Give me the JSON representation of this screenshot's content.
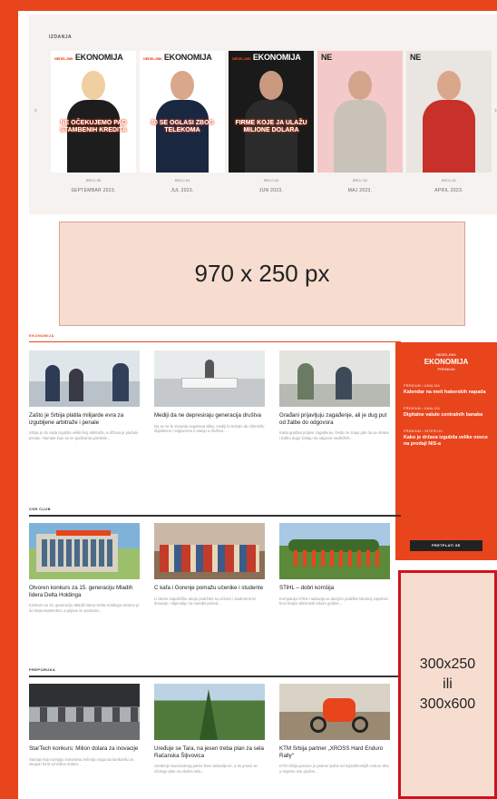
{
  "issues": {
    "label": "IZDANJA",
    "covers": [
      {
        "masthead": "EKONOMIJA",
        "masthead_prefix": "NEDELJNIK",
        "headline": "Ne očekujemo pad stambenih kredita",
        "issue_no": "BROJ 85",
        "date": "SEPTEMBAR 2023.",
        "bg": "#ffffff",
        "person_body": "#1d1d1d",
        "person_head": "#f0cfa0"
      },
      {
        "masthead": "EKONOMIJA",
        "masthead_prefix": "NEDELJNIK",
        "headline": "30 se oglasi zbog telekoma",
        "issue_no": "BROJ 84",
        "date": "JUL 2023.",
        "bg": "#ffffff",
        "person_body": "#1a2740",
        "person_head": "#d9a78a"
      },
      {
        "masthead": "EKONOMIJA",
        "masthead_prefix": "NEDELJNIK",
        "headline": "Firme koje ja ulažu milione dolara",
        "issue_no": "BROJ 83",
        "date": "JUN 2023.",
        "bg": "#1a1a1a",
        "person_body": "#2b2b2b",
        "person_head": "#c99a80"
      },
      {
        "masthead": "NE",
        "masthead_prefix": "",
        "headline": "",
        "issue_no": "BROJ 82",
        "date": "MAJ 2023.",
        "bg": "#f4c9c9",
        "person_body": "#c9c2b8",
        "person_head": "#d3a68c"
      },
      {
        "masthead": "NE",
        "masthead_prefix": "",
        "headline": "",
        "issue_no": "BROJ 81",
        "date": "APRIL 2023.",
        "bg": "#e9e5e0",
        "person_body": "#c8302a",
        "person_head": "#d9a78a"
      }
    ]
  },
  "ad_banner": {
    "text": "970 x 250 px"
  },
  "sections": {
    "finance": {
      "label": "EKONOMIJA",
      "cards": [
        {
          "title": "Zašto je Srbija platila milijarde evra za izgubljene arbitraže i penale",
          "excerpt": "Srbija je do sada izgubila veliki broj arbitraža, a država je plaćala penale i kamate koje su se godinama gomilale..."
        },
        {
          "title": "Mediji da ne depresiraju generacija društva",
          "excerpt": "Da se ne bi stvarala negativna slika, mediji bi trebalo da informišu objektivno i odgovorno o stanju u društvu..."
        },
        {
          "title": "Građani prijavljuju zagađenje, ali je dug put od žalbe do odgovora",
          "excerpt": "Kada građani prijave zagađenje, često ne znaju gde da se obrate i koliko dugo čekaju na odgovor nadležnih..."
        }
      ]
    },
    "csr": {
      "label": "CSR CLUB",
      "cards": [
        {
          "title": "Otvoren konkurs za 15. generaciju Mladih lidera Delta Holdinga",
          "excerpt": "Konkurs za 15. generaciju Mladih lidera Delta Holdinga otvoren je do kraja septembra, a prijave se podnose..."
        },
        {
          "title": "C kafa i Gorenje pomažu učenike i studente",
          "excerpt": "U okviru zajedničke akcije podržani su učenici i studenti kroz donacije i stipendije za naredni period..."
        },
        {
          "title": "STiHL – dobri komšija",
          "excerpt": "Kompanija STiHL nastavlja sa akcijom podrške lokalnoj zajednici kroz brojne aktivnosti tokom godine..."
        }
      ]
    },
    "recommend": {
      "label": "PREPORUKA",
      "cards": [
        {
          "title": "StarTech konkurs: Milion dolara za inovacije",
          "excerpt": "Startapi koji razvijaju inovativna rešenja mogu da konkurišu za ukupan fond od milion dolara..."
        },
        {
          "title": "Uređuje se Tara, na jesen treba plan za sela Račanska Šljivovica",
          "excerpt": "Uređenje Nacionalnog parka Tara nastavlja se, a do jeseni se očekuje plan za okolna sela..."
        },
        {
          "title": "KTM Srbija partner „XROSS Hard Enduro Rally“",
          "excerpt": "KTM Srbija ponovo je partner jedne od najzahtevnijih enduro trka u regionu ove godine..."
        }
      ]
    }
  },
  "premium": {
    "logo_top": "NEDELJNIK",
    "logo_main": "EKONOMIJA",
    "logo_sub": "PREMIUM",
    "items": [
      {
        "kicker": "PREMIUM • ANALIZA",
        "title": "Kalendar na meti hakerskih napada"
      },
      {
        "kicker": "PREMIUM • ANALIZA",
        "title": "Digitalne valute centralnih banaka"
      },
      {
        "kicker": "PREMIUM • INTERVJU",
        "title": "Kako je država izgubila velike novce na prodaji NIS-a"
      }
    ],
    "button": "PRETPLATI SE"
  },
  "ad_side": {
    "text": "300x250\nili\n300x600"
  },
  "colors": {
    "brand": "#e8451d",
    "ad_border": "#d0121b",
    "ad_fill": "#f7ddd0"
  }
}
